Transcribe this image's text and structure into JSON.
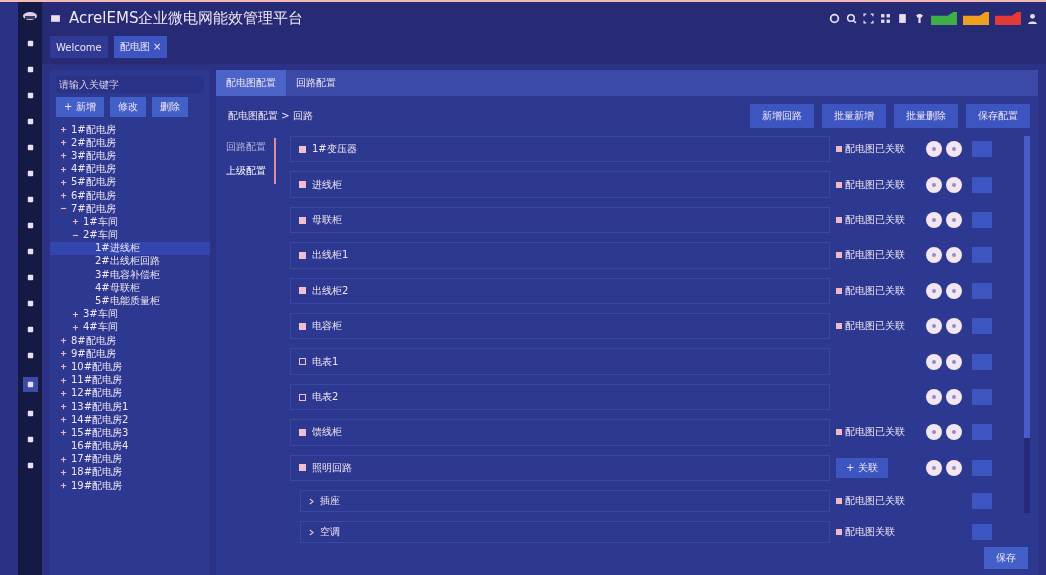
{
  "header": {
    "title": "AcrelEMS企业微电网能效管理平台",
    "alerts": [
      {
        "color": "#3fae49"
      },
      {
        "color": "#f0a020"
      },
      {
        "color": "#e53935"
      }
    ]
  },
  "page_tabs": [
    {
      "label": "Welcome",
      "selected": false
    },
    {
      "label": "配电图 ×",
      "selected": true
    }
  ],
  "tree_panel": {
    "search": {
      "placeholder": "请输入关键字"
    },
    "buttons": [
      "+ 新增",
      "修改",
      "删除"
    ]
  },
  "tree": [
    {
      "label": "1#配电房",
      "expanded": false,
      "selected": false
    },
    {
      "label": "2#配电房",
      "expanded": false,
      "selected": false
    },
    {
      "label": "3#配电房",
      "expanded": false,
      "selected": false
    },
    {
      "label": "4#配电房",
      "expanded": false,
      "selected": false
    },
    {
      "label": "5#配电房",
      "expanded": false,
      "selected": false
    },
    {
      "label": "6#配电房",
      "expanded": false,
      "selected": false
    },
    {
      "label": "7#配电房",
      "expanded": true,
      "selected": false,
      "children": [
        {
          "label": "1#车间",
          "expanded": false,
          "selected": false
        },
        {
          "label": "2#车间",
          "expanded": true,
          "selected": false,
          "children": [
            {
              "label": "1#进线柜",
              "selected": true
            },
            {
              "label": "2#出线柜回路",
              "selected": false
            },
            {
              "label": "3#电容补偿柜",
              "selected": false
            },
            {
              "label": "4#母联柜",
              "selected": false
            },
            {
              "label": "5#电能质量柜",
              "selected": false
            }
          ]
        },
        {
          "label": "3#车间",
          "expanded": false,
          "selected": false
        },
        {
          "label": "4#车间",
          "expanded": false,
          "selected": false
        }
      ]
    },
    {
      "label": "8#配电房",
      "expanded": false,
      "selected": false
    },
    {
      "label": "9#配电房",
      "expanded": false,
      "selected": false
    },
    {
      "label": "10#配电房",
      "expanded": false,
      "selected": false
    },
    {
      "label": "11#配电房",
      "expanded": false,
      "selected": false
    },
    {
      "label": "12#配电房",
      "expanded": false,
      "selected": false
    },
    {
      "label": "13#配电房1",
      "expanded": false,
      "selected": false
    },
    {
      "label": "14#配电房2",
      "expanded": false,
      "selected": false
    },
    {
      "label": "15#配电房3",
      "expanded": false,
      "selected": false
    },
    {
      "label": "16#配电房4",
      "selected": false
    },
    {
      "label": "17#配电房",
      "expanded": false,
      "selected": false
    },
    {
      "label": "18#配电房",
      "expanded": false,
      "selected": false
    },
    {
      "label": "19#配电房",
      "expanded": false,
      "selected": false
    }
  ],
  "content_tabs": [
    {
      "label": "配电图配置",
      "selected": true
    },
    {
      "label": "回路配置",
      "selected": false
    }
  ],
  "breadcrumb": "配电图配置 > 回路",
  "side_tabs": [
    {
      "label": "回路配置",
      "selected": false
    },
    {
      "label": "上级配置",
      "selected": true
    }
  ],
  "toolbar": [
    "新增回路",
    "批量新增",
    "批量删除",
    "保存配置"
  ],
  "rows": [
    {
      "kind": "parent",
      "label": "1#变压器",
      "checked": true,
      "tag": "配电图已关联"
    },
    {
      "kind": "parent",
      "label": "进线柜",
      "checked": true,
      "tag": "配电图已关联"
    },
    {
      "kind": "parent",
      "label": "母联柜",
      "checked": true,
      "tag": "配电图已关联"
    },
    {
      "kind": "parent",
      "label": "出线柜1",
      "checked": true,
      "tag": "配电图已关联"
    },
    {
      "kind": "parent",
      "label": "出线柜2",
      "checked": true,
      "tag": "配电图已关联"
    },
    {
      "kind": "parent",
      "label": "电容柜",
      "checked": true,
      "tag": "配电图已关联"
    },
    {
      "kind": "parent",
      "label": "电表1",
      "checked": false
    },
    {
      "kind": "parent",
      "label": "电表2",
      "checked": false
    },
    {
      "kind": "parent",
      "label": "馈线柜",
      "checked": true,
      "tag": "配电图已关联"
    },
    {
      "kind": "parent",
      "label": "照明回路",
      "checked": true,
      "link_button": "+ 关联"
    },
    {
      "kind": "child",
      "label": "插座",
      "tag": "配电图已关联"
    },
    {
      "kind": "child",
      "label": "空调",
      "tag": "配电图关联"
    }
  ],
  "save_button": "保存"
}
